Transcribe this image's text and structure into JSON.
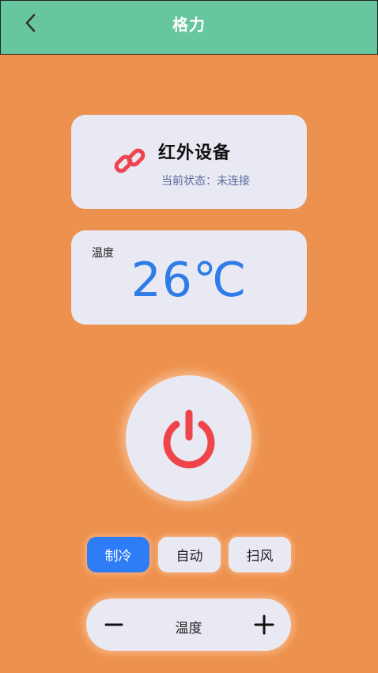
{
  "header": {
    "title": "格力",
    "back_icon": "chevron-left-icon"
  },
  "device": {
    "icon": "link-icon",
    "name": "红外设备",
    "status": "当前状态：未连接"
  },
  "temperature": {
    "label": "温度",
    "value": "26℃"
  },
  "power": {
    "icon": "power-icon"
  },
  "modes": [
    {
      "label": "制冷",
      "active": true
    },
    {
      "label": "自动",
      "active": false
    },
    {
      "label": "扫风",
      "active": false
    }
  ],
  "temp_control": {
    "minus_icon": "minus-icon",
    "label": "温度",
    "plus_icon": "plus-icon"
  },
  "colors": {
    "background": "#ED924E",
    "header": "#68C69E",
    "card": "#E8E9F3",
    "accent_blue": "#2E7CF6",
    "power_red": "#F0444B"
  }
}
